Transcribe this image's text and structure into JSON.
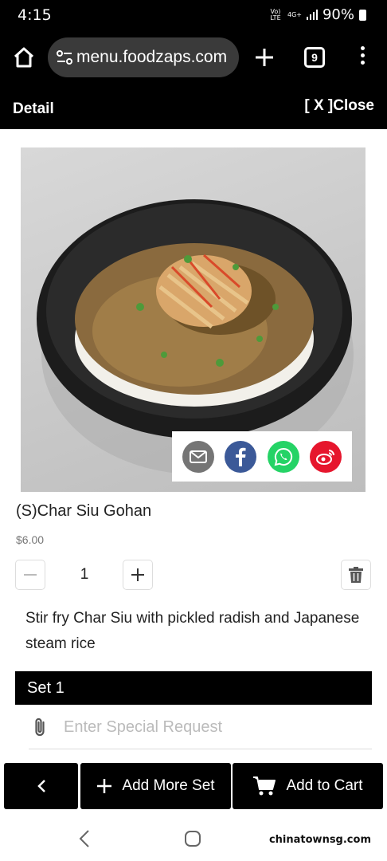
{
  "status": {
    "time": "4:15",
    "network_top": "4G+",
    "network_left": "Vo) LTE",
    "battery": "90%"
  },
  "browser": {
    "url": "menu.foodzaps.com",
    "tab_count": "9"
  },
  "detail": {
    "title": "Detail",
    "close_label": "[ X ]Close"
  },
  "product": {
    "name": "(S)Char Siu Gohan",
    "price": "$6.00",
    "quantity": "1",
    "description": "Stir fry Char Siu with pickled radish and Japanese steam rice"
  },
  "share": {
    "icons": [
      "email-icon",
      "facebook-icon",
      "whatsapp-icon",
      "weibo-icon"
    ],
    "colors": {
      "email": "#757575",
      "facebook": "#3b5998",
      "whatsapp": "#25d366",
      "weibo": "#e6162d"
    }
  },
  "set": {
    "label": "Set 1",
    "request_placeholder": "Enter Special Request"
  },
  "actions": {
    "add_more_set": "Add More Set",
    "add_to_cart": "Add to Cart"
  },
  "watermark": "chinatownsg.com"
}
